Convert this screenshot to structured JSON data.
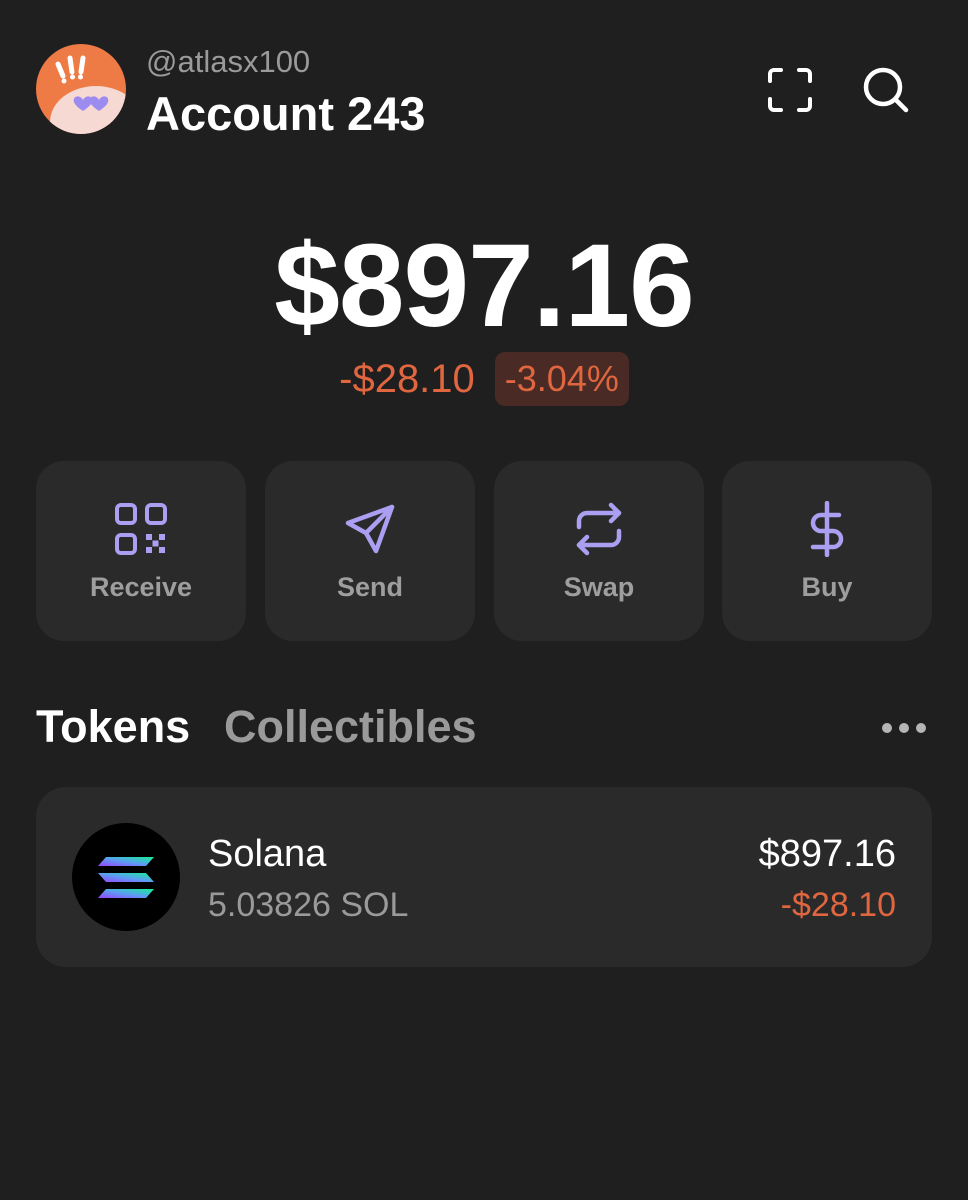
{
  "header": {
    "username": "@atlasx100",
    "account_name": "Account 243",
    "scan_icon": "scan-qr-icon",
    "search_icon": "search-icon"
  },
  "balance": {
    "total": "$897.16",
    "change_amount": "-$28.10",
    "change_percent": "-3.04%"
  },
  "actions": [
    {
      "label": "Receive",
      "icon": "qr-code-icon"
    },
    {
      "label": "Send",
      "icon": "send-icon"
    },
    {
      "label": "Swap",
      "icon": "swap-icon"
    },
    {
      "label": "Buy",
      "icon": "dollar-icon"
    }
  ],
  "tabs": {
    "active": "Tokens",
    "inactive": "Collectibles",
    "more_icon": "more-horizontal-icon"
  },
  "tokens": [
    {
      "name": "Solana",
      "amount": "5.03826 SOL",
      "value": "$897.16",
      "change": "-$28.10",
      "icon": "solana-logo-icon"
    }
  ],
  "colors": {
    "background": "#1f1f1f",
    "card": "#2a2a2a",
    "accent_purple": "#ab9ff2",
    "negative": "#e0663f",
    "avatar_bg": "#ee7a45"
  }
}
